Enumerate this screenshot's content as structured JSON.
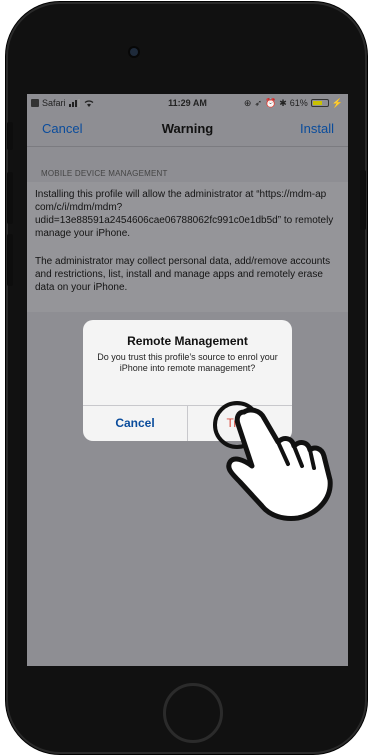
{
  "status_bar": {
    "carrier": "Safari",
    "time": "11:29 AM",
    "battery": "61%"
  },
  "nav": {
    "cancel": "Cancel",
    "title": "Warning",
    "install": "Install"
  },
  "section": {
    "header": "MOBILE DEVICE MANAGEMENT",
    "paragraph1": "Installing this profile will allow the administrator at “https://mdm-ap                com/c/i/mdm/mdm?udid=13e88591a2454606cae06788062fc991c0e1db5d” to remotely manage your iPhone.",
    "paragraph2": "The administrator may collect personal data, add/remove accounts and restrictions, list, install and manage apps and remotely erase data on your iPhone."
  },
  "alert": {
    "title": "Remote Management",
    "message": "Do you trust this profile’s source to enrol your iPhone into remote management?",
    "cancel": "Cancel",
    "trust": "Trust"
  },
  "colors": {
    "accent": "#0a4c9c",
    "destructive": "#d94a3c"
  }
}
